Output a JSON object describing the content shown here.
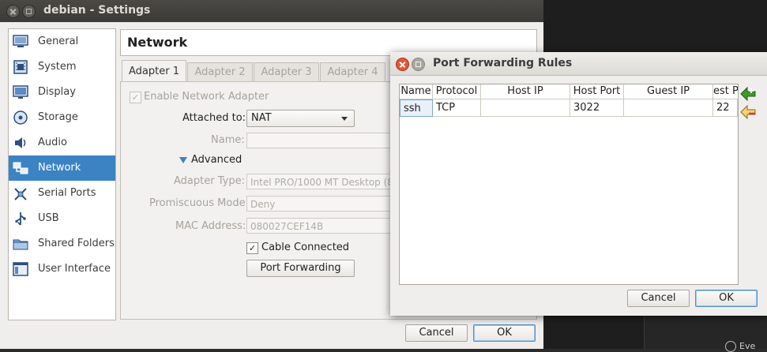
{
  "settings": {
    "window_title": "debian - Settings",
    "sidebar": [
      {
        "label": "General",
        "icon": "monitor-icon"
      },
      {
        "label": "System",
        "icon": "chip-icon"
      },
      {
        "label": "Display",
        "icon": "display-icon"
      },
      {
        "label": "Storage",
        "icon": "disk-icon"
      },
      {
        "label": "Audio",
        "icon": "speaker-icon"
      },
      {
        "label": "Network",
        "icon": "network-icon",
        "active": true
      },
      {
        "label": "Serial Ports",
        "icon": "serial-ports-icon"
      },
      {
        "label": "USB",
        "icon": "usb-icon"
      },
      {
        "label": "Shared Folders",
        "icon": "shared-folder-icon"
      },
      {
        "label": "User Interface",
        "icon": "user-interface-icon"
      }
    ],
    "page_title": "Network",
    "tabs": [
      {
        "label": "Adapter 1",
        "active": true
      },
      {
        "label": "Adapter 2"
      },
      {
        "label": "Adapter 3"
      },
      {
        "label": "Adapter 4"
      }
    ],
    "enable_adapter_label": "Enable Network Adapter",
    "enable_adapter_checked": true,
    "attached_to_label": "Attached to:",
    "attached_to_value": "NAT",
    "name_label": "Name:",
    "name_value": "",
    "advanced_label": "Advanced",
    "adapter_type_label": "Adapter Type:",
    "adapter_type_value": "Intel PRO/1000 MT Desktop (8",
    "promiscuous_label": "Promiscuous Mode:",
    "promiscuous_value": "Deny",
    "mac_label": "MAC Address:",
    "mac_value": "080027CEF14B",
    "cable_connected_label": "Cable Connected",
    "cable_connected_checked": true,
    "port_forwarding_button": "Port Forwarding",
    "cancel_button": "Cancel",
    "ok_button": "OK"
  },
  "port_forwarding": {
    "title": "Port Forwarding Rules",
    "columns": [
      "Name",
      "Protocol",
      "Host IP",
      "Host Port",
      "Guest IP",
      "est P"
    ],
    "rows": [
      {
        "name": "ssh",
        "protocol": "TCP",
        "host_ip": "",
        "host_port": "3022",
        "guest_ip": "",
        "guest_port": "22"
      }
    ],
    "cancel_button": "Cancel",
    "ok_button": "OK"
  },
  "desktop": {
    "chip_text": "Eve"
  },
  "colors": {
    "selection": "#3c83c4",
    "titlebar_dark": "#3b3a36",
    "dialog_close": "#e2563a",
    "add_rule_green": "#3f9a2b",
    "remove_rule_red": "#d33a2a"
  }
}
